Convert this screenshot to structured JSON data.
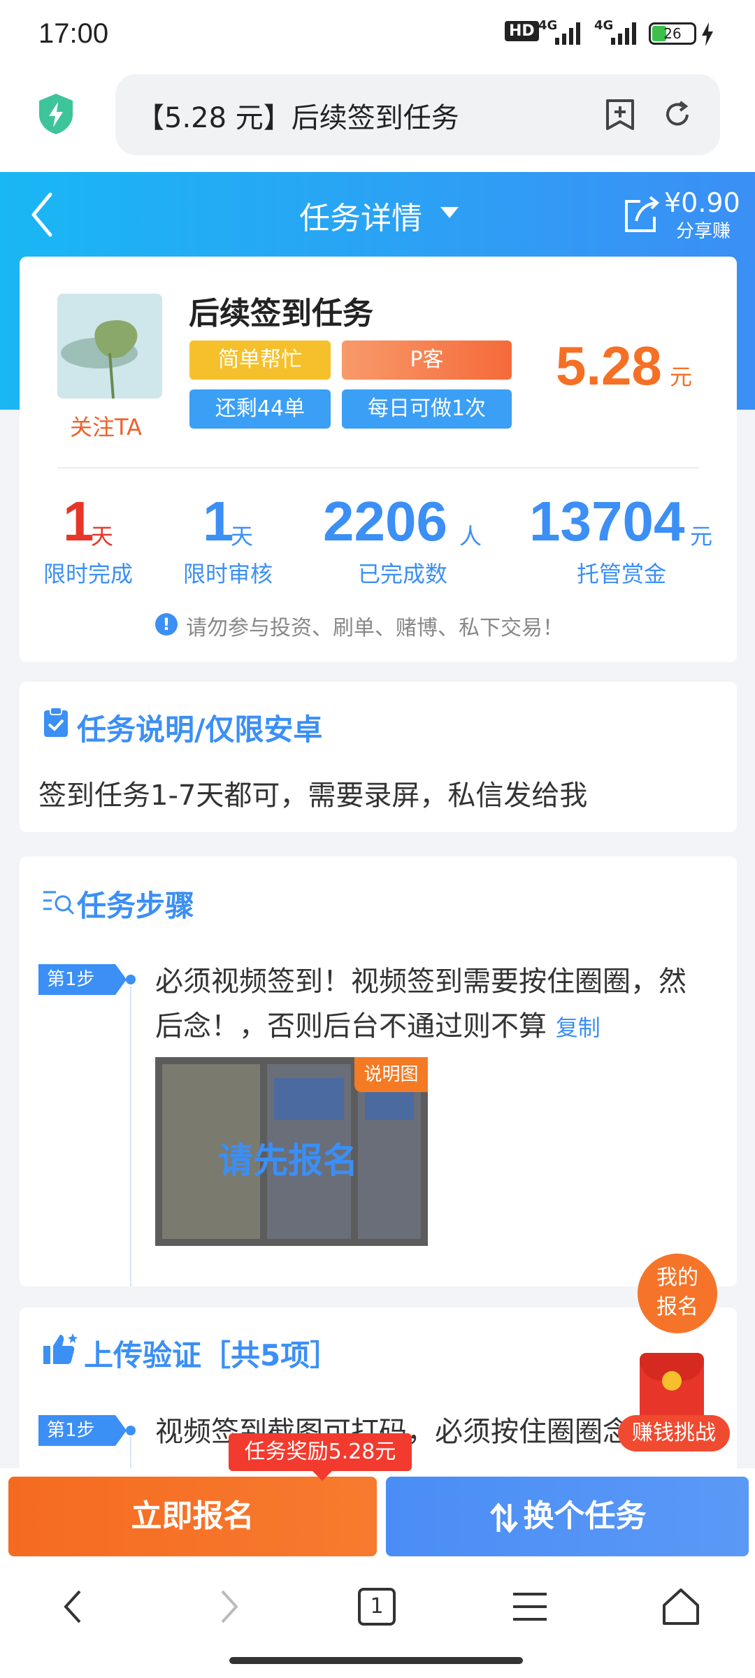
{
  "status_bar": {
    "time": "17:00",
    "network": "HD",
    "signal_1": "4G",
    "signal_2": "4G",
    "battery": "26"
  },
  "browser": {
    "url_title": "【5.28 元】后续签到任务"
  },
  "header": {
    "title": "任务详情",
    "share_amount": "¥0.90",
    "share_label": "分享赚"
  },
  "task": {
    "title": "后续签到任务",
    "follow_label": "关注TA",
    "tags": [
      "简单帮忙",
      "P客",
      "还剩44单",
      "每日可做1次"
    ],
    "reward_value": "5.28",
    "reward_unit": "元",
    "stats": [
      {
        "value": "1",
        "unit": "天",
        "label": "限时完成"
      },
      {
        "value": "1",
        "unit": "天",
        "label": "限时审核"
      },
      {
        "value": "2206",
        "unit": "人",
        "label": "已完成数"
      },
      {
        "value": "13704",
        "unit": "元",
        "label": "托管赏金"
      }
    ],
    "warning": "请勿参与投资、刷单、赌博、私下交易！"
  },
  "description": {
    "title": "任务说明/仅限安卓",
    "text": "签到任务1-7天都可，需要录屏，私信发给我"
  },
  "steps": {
    "title": "任务步骤",
    "step1_badge": "第1步",
    "step1_text": "必须视频签到！视频签到需要按住圈圈，然后念！，否则后台不通过则不算",
    "copy_label": "复制",
    "image_badge": "说明图",
    "image_overlay": "请先报名"
  },
  "upload": {
    "title": "上传验证［共5项］",
    "step1_badge": "第1步",
    "step1_text": "视频签到截图可打码，必须按住圈圈念"
  },
  "floating": {
    "my_signup": "我的\n报名",
    "challenge": "赚钱挑战"
  },
  "actions": {
    "reward_tip": "任务奖励5.28元",
    "signup": "立即报名",
    "change": "换个任务"
  },
  "nav": {
    "tab_count": "1"
  },
  "colors": {
    "primary_blue": "#3b8ff5",
    "orange": "#f57024",
    "red": "#e8352a"
  }
}
